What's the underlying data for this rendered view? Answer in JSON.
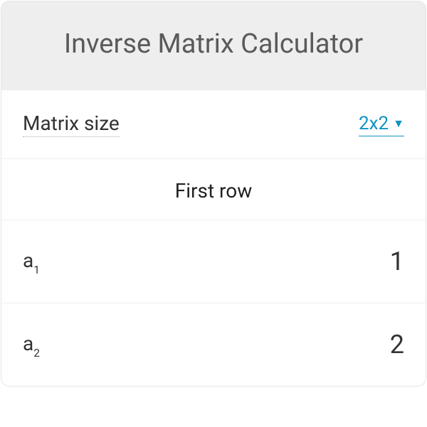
{
  "title": "Inverse Matrix Calculator",
  "matrixSize": {
    "label": "Matrix size",
    "value": "2x2"
  },
  "rows": [
    {
      "heading": "First row",
      "cells": [
        {
          "label": "a",
          "sub": "1",
          "value": "1"
        },
        {
          "label": "a",
          "sub": "2",
          "value": "2"
        }
      ]
    }
  ]
}
